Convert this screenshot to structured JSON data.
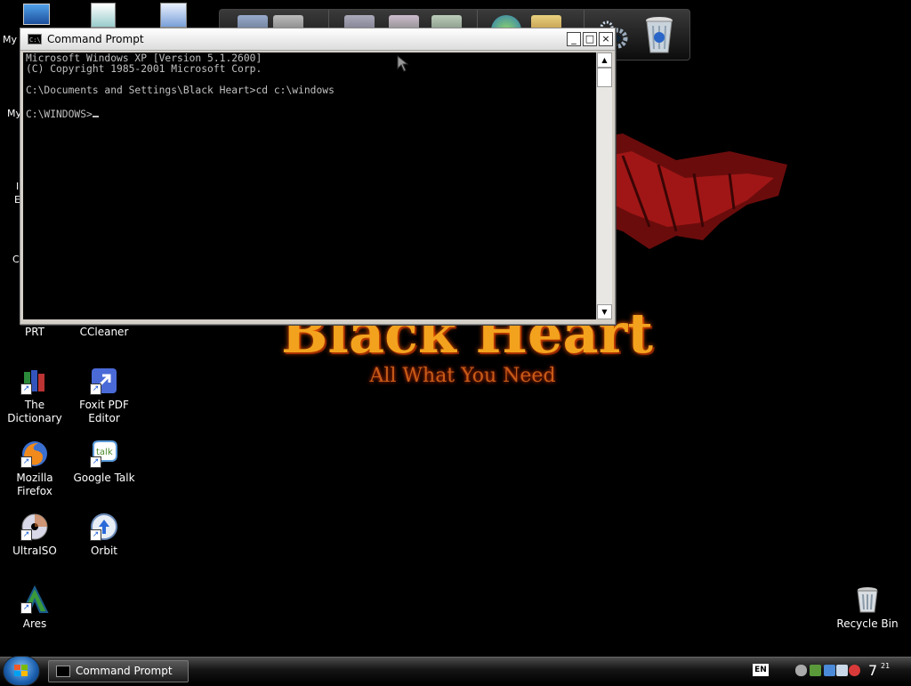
{
  "wallpaper": {
    "title": "Black Heart",
    "slogan": "All What You Need"
  },
  "desktop_icons": [
    {
      "id": "prt",
      "label": "PRT",
      "icon": "printer-folder-icon"
    },
    {
      "id": "ccleaner",
      "label": "CCleaner",
      "icon": "ccleaner-icon"
    },
    {
      "id": "dictionary",
      "label": "The Dictionary",
      "icon": "books-icon"
    },
    {
      "id": "foxit",
      "label": "Foxit PDF Editor",
      "icon": "foxit-icon"
    },
    {
      "id": "firefox",
      "label": "Mozilla Firefox",
      "icon": "firefox-icon"
    },
    {
      "id": "gtalk",
      "label": "Google Talk",
      "icon": "google-talk-icon"
    },
    {
      "id": "ultraiso",
      "label": "UltraISO",
      "icon": "disc-icon"
    },
    {
      "id": "orbit",
      "label": "Orbit",
      "icon": "orbit-icon"
    },
    {
      "id": "ares",
      "label": "Ares",
      "icon": "ares-icon"
    },
    {
      "id": "recycle",
      "label": "Recycle Bin",
      "icon": "recycle-bin-icon"
    }
  ],
  "partial_labels": [
    "My",
    "My",
    "I",
    "E",
    "C"
  ],
  "cmd_window": {
    "title": "Command Prompt",
    "icon_text": "C:\\",
    "minimize": "_",
    "maximize": "□",
    "close": "×",
    "lines": [
      "Microsoft Windows XP [Version 5.1.2600]",
      "(C) Copyright 1985-2001 Microsoft Corp.",
      "",
      "C:\\Documents and Settings\\Black Heart>cd c:\\windows",
      "",
      "C:\\WINDOWS>"
    ]
  },
  "taskbar": {
    "task_label": "Command Prompt",
    "language": "EN",
    "clock_hour": "7",
    "clock_minute": "21"
  },
  "colors": {
    "console_bg": "#000000",
    "console_text": "#c0c0c0",
    "wallpaper_title": "#f3a21e"
  }
}
